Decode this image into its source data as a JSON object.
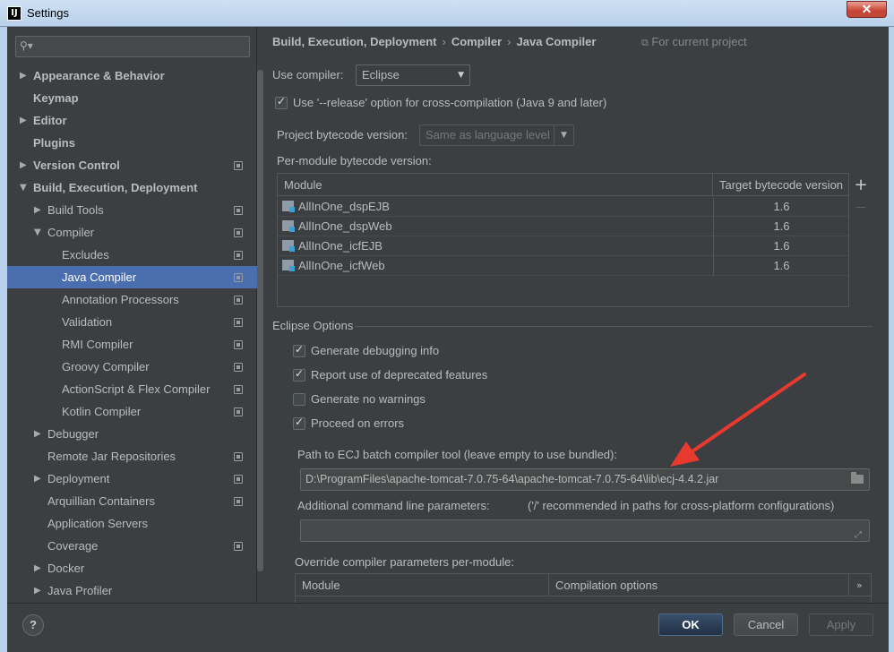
{
  "window": {
    "title": "Settings",
    "app_icon": "IJ",
    "close_label": "✕"
  },
  "search": {
    "placeholder": "",
    "icon": "search-icon"
  },
  "sidebar": {
    "items": [
      {
        "label": "Appearance & Behavior",
        "level": 0,
        "arrow": "▶",
        "bold": true
      },
      {
        "label": "Keymap",
        "level": 0,
        "arrow": "",
        "bold": true
      },
      {
        "label": "Editor",
        "level": 0,
        "arrow": "▶",
        "bold": true
      },
      {
        "label": "Plugins",
        "level": 0,
        "arrow": "",
        "bold": true
      },
      {
        "label": "Version Control",
        "level": 0,
        "arrow": "▶",
        "bold": true,
        "project": true
      },
      {
        "label": "Build, Execution, Deployment",
        "level": 0,
        "arrow": "▼",
        "bold": true
      },
      {
        "label": "Build Tools",
        "level": 1,
        "arrow": "▶",
        "project": true
      },
      {
        "label": "Compiler",
        "level": 1,
        "arrow": "▼",
        "project": true
      },
      {
        "label": "Excludes",
        "level": 2,
        "arrow": "",
        "project": true
      },
      {
        "label": "Java Compiler",
        "level": 2,
        "arrow": "",
        "project": true,
        "selected": true
      },
      {
        "label": "Annotation Processors",
        "level": 2,
        "arrow": "",
        "project": true
      },
      {
        "label": "Validation",
        "level": 2,
        "arrow": "",
        "project": true
      },
      {
        "label": "RMI Compiler",
        "level": 2,
        "arrow": "",
        "project": true
      },
      {
        "label": "Groovy Compiler",
        "level": 2,
        "arrow": "",
        "project": true
      },
      {
        "label": "ActionScript & Flex Compiler",
        "level": 2,
        "arrow": "",
        "project": true
      },
      {
        "label": "Kotlin Compiler",
        "level": 2,
        "arrow": "",
        "project": true
      },
      {
        "label": "Debugger",
        "level": 1,
        "arrow": "▶"
      },
      {
        "label": "Remote Jar Repositories",
        "level": 1,
        "arrow": "",
        "project": true
      },
      {
        "label": "Deployment",
        "level": 1,
        "arrow": "▶",
        "project": true
      },
      {
        "label": "Arquillian Containers",
        "level": 1,
        "arrow": "",
        "project": true
      },
      {
        "label": "Application Servers",
        "level": 1,
        "arrow": ""
      },
      {
        "label": "Coverage",
        "level": 1,
        "arrow": "",
        "project": true
      },
      {
        "label": "Docker",
        "level": 1,
        "arrow": "▶"
      },
      {
        "label": "Java Profiler",
        "level": 1,
        "arrow": "▶"
      }
    ]
  },
  "breadcrumb": {
    "part1": "Build, Execution, Deployment",
    "sep": "›",
    "part2": "Compiler",
    "part3": "Java Compiler",
    "for_project": "For current project",
    "project_icon": "project-scope-icon"
  },
  "compiler": {
    "use_compiler_label": "Use compiler:",
    "use_compiler_value": "Eclipse",
    "release_option_label": "Use '--release' option for cross-compilation (Java 9 and later)",
    "release_option_checked": true,
    "project_bytecode_label": "Project bytecode version:",
    "project_bytecode_value": "Same as language level",
    "per_module_label": "Per-module bytecode version:"
  },
  "module_table": {
    "headers": [
      "Module",
      "Target bytecode version"
    ],
    "rows": [
      {
        "module": "AllInOne_dspEJB",
        "version": "1.6"
      },
      {
        "module": "AllInOne_dspWeb",
        "version": "1.6"
      },
      {
        "module": "AllInOne_icfEJB",
        "version": "1.6"
      },
      {
        "module": "AllInOne_icfWeb",
        "version": "1.6"
      }
    ],
    "add_label": "+",
    "remove_label": "—"
  },
  "eclipse": {
    "section_title": "Eclipse Options",
    "options": [
      {
        "label": "Generate debugging info",
        "checked": true
      },
      {
        "label": "Report use of deprecated features",
        "checked": true
      },
      {
        "label": "Generate no warnings",
        "checked": false
      },
      {
        "label": "Proceed on errors",
        "checked": true
      }
    ],
    "ecj_path_label": "Path to ECJ batch compiler tool (leave empty to use bundled):",
    "ecj_path_value": "D:\\ProgramFiles\\apache-tomcat-7.0.75-64\\apache-tomcat-7.0.75-64\\lib\\ecj-4.4.2.jar",
    "additional_params_label": "Additional command line parameters:",
    "additional_params_hint": "('/' recommended in paths for cross-platform configurations)",
    "additional_params_value": "",
    "override_label": "Override compiler parameters per-module:",
    "override_headers": [
      "Module",
      "Compilation options"
    ],
    "override_more": "»"
  },
  "footer": {
    "help_label": "?",
    "ok_label": "OK",
    "cancel_label": "Cancel",
    "apply_label": "Apply"
  },
  "colors": {
    "background": "#3c3f41",
    "selection": "#4b6eaf",
    "annotation_arrow": "#e8392f"
  }
}
